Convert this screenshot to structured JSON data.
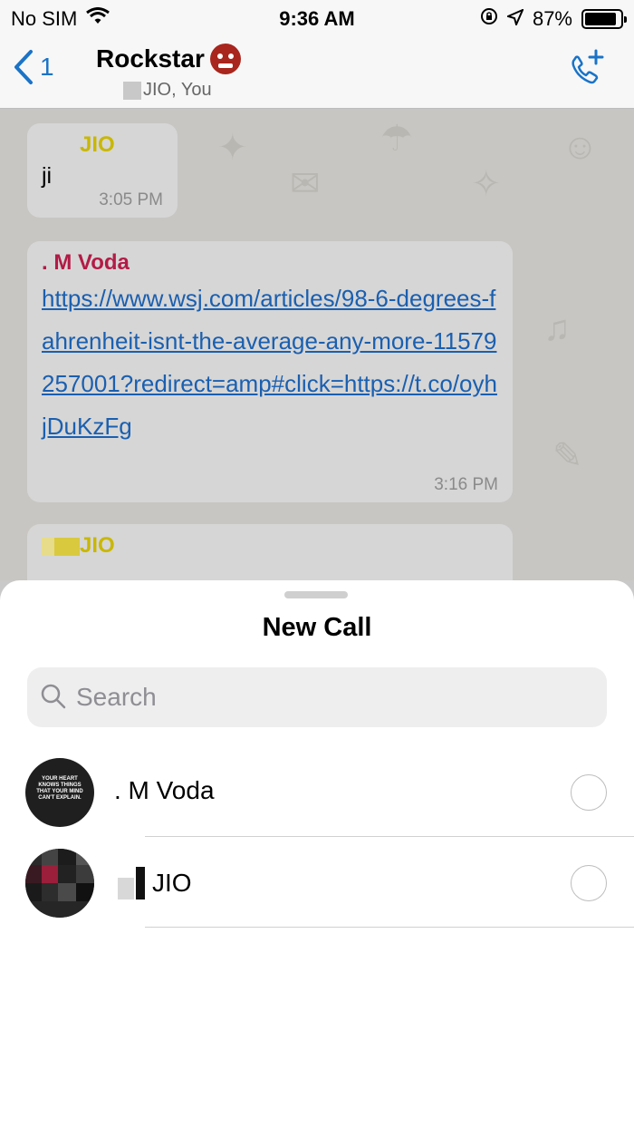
{
  "status_bar": {
    "carrier": "No SIM",
    "time": "9:36 AM",
    "battery": "87%",
    "battery_level": 0.87
  },
  "nav": {
    "back_count": "1",
    "title": "Rockstar",
    "title_emoji_icon": "ogre-icon",
    "subtitle": "JIO, You"
  },
  "messages": [
    {
      "sender": "JIO",
      "text": "ji",
      "time": "3:05 PM"
    },
    {
      "sender": ". M Voda",
      "link": "https://www.wsj.com/articles/98-6-degrees-fahrenheit-isnt-the-average-any-more-11579257001?redirect=amp#click=https://t.co/oyhjDuKzFg",
      "time": "3:16 PM"
    },
    {
      "sender": "JIO"
    }
  ],
  "sheet": {
    "title": "New Call",
    "search_placeholder": "Search",
    "contacts": [
      {
        "name": ". M Voda",
        "avatar_text": "YOUR HEART KNOWS THINGS THAT YOUR MIND CAN'T EXPLAIN."
      },
      {
        "name": "JIO"
      }
    ]
  },
  "colors": {
    "accent": "#1a73c7",
    "sender_jio": "#c9b700",
    "sender_voda": "#b31b46",
    "link": "#1a5fb0"
  }
}
